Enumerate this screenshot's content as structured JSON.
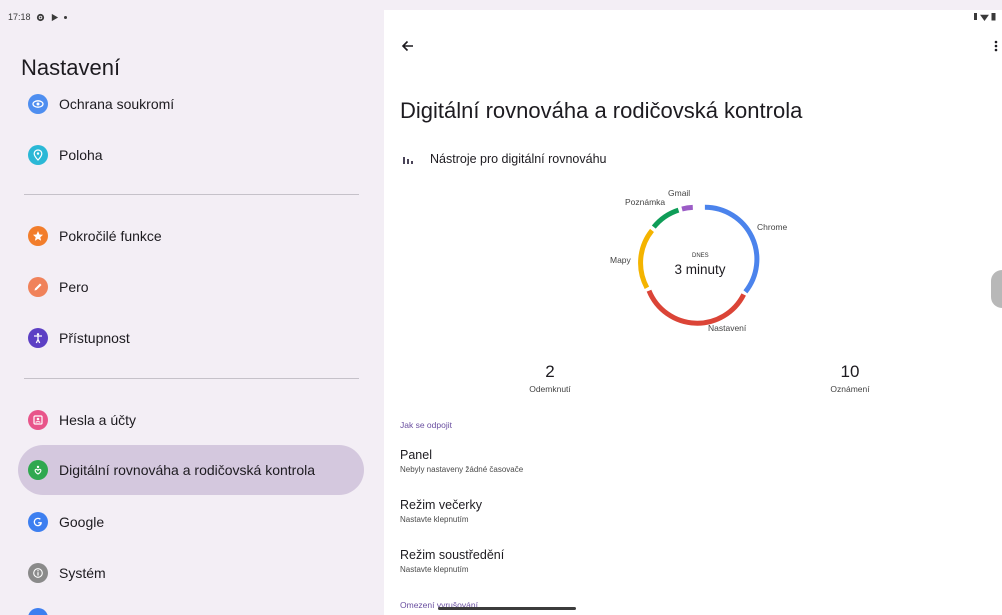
{
  "status_bar": {
    "time": "17:18"
  },
  "left": {
    "title": "Nastavení",
    "items": [
      {
        "label": "Ochrana soukromí",
        "icon": "eye-icon",
        "color": "#4e8ef0"
      },
      {
        "label": "Poloha",
        "icon": "location-pin-icon",
        "color": "#2ab8d6"
      },
      {
        "label": "Pokročilé funkce",
        "icon": "star-icon",
        "color": "#f27d2b"
      },
      {
        "label": "Pero",
        "icon": "pen-icon",
        "color": "#f0825a"
      },
      {
        "label": "Přístupnost",
        "icon": "accessibility-icon",
        "color": "#5c3fc4"
      },
      {
        "label": "Hesla a účty",
        "icon": "account-box-icon",
        "color": "#e8558a"
      },
      {
        "label": "Digitální rovnováha a rodičovská kontrola",
        "icon": "digital-wellbeing-icon",
        "color": "#2fa84f"
      },
      {
        "label": "Google",
        "icon": "google-icon",
        "color": "#3d7ff0"
      },
      {
        "label": "Systém",
        "icon": "info-icon",
        "color": "#8a8a8a"
      }
    ]
  },
  "right": {
    "title": "Digitální rovnováha a rodičovská kontrola",
    "tools_label": "Nástroje pro digitální rovnováhu",
    "chart": {
      "center_top": "DNES",
      "center_value": "3 minuty",
      "labels": {
        "gmail": "Gmail",
        "poznamka": "Poznámka",
        "chrome": "Chrome",
        "mapy": "Mapy",
        "nastaveni": "Nastavení"
      }
    },
    "stats": [
      {
        "value": "2",
        "label": "Odemknutí"
      },
      {
        "value": "10",
        "label": "Oznámení"
      }
    ],
    "section1": "Jak se odpojit",
    "list": [
      {
        "title": "Panel",
        "subtitle": "Nebyly nastaveny žádné časovače"
      },
      {
        "title": "Režim večerky",
        "subtitle": "Nastavte klepnutím"
      },
      {
        "title": "Režim soustředění",
        "subtitle": "Nastavte klepnutím"
      }
    ],
    "section2": "Omezení vyrušování"
  },
  "colors": {
    "chrome": "#4b83ec",
    "nastaveni": "#db4437",
    "mapy": "#f4b400",
    "poznamka": "#0f9d58",
    "gmail": "#9b5cc6",
    "selected_bg": "#d4c8de"
  }
}
